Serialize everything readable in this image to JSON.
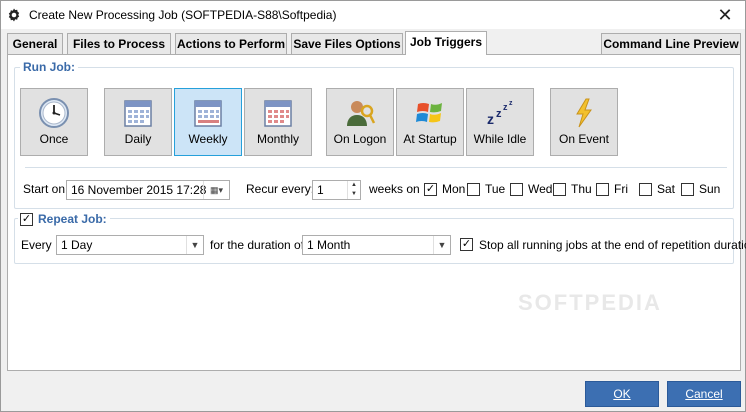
{
  "window": {
    "title": "Create New Processing Job (SOFTPEDIA-S88\\Softpedia)",
    "close": "✕"
  },
  "tabs": [
    {
      "label": "General"
    },
    {
      "label": "Files to Process"
    },
    {
      "label": "Actions to Perform"
    },
    {
      "label": "Save Files Options"
    },
    {
      "label": "Job Triggers"
    },
    {
      "label": "Command Line Preview"
    }
  ],
  "active_tab": "Job Triggers",
  "run_job": {
    "label": "Run Job:",
    "buttons": [
      {
        "label": "Once",
        "icon": "clock-icon"
      },
      {
        "label": "Daily",
        "icon": "calendar-icon"
      },
      {
        "label": "Weekly",
        "icon": "calendar-icon"
      },
      {
        "label": "Monthly",
        "icon": "calendar-red-icon"
      },
      {
        "label": "On Logon",
        "icon": "user-key-icon"
      },
      {
        "label": "At Startup",
        "icon": "windows-logo-icon"
      },
      {
        "label": "While Idle",
        "icon": "sleep-zzz-icon"
      },
      {
        "label": "On Event",
        "icon": "lightning-icon"
      }
    ],
    "selected": "Weekly",
    "start_on_label": "Start on:",
    "start_on_value": "16 November 2015 17:28",
    "recur_label": "Recur every:",
    "recur_value": "1",
    "weeks_on_label": "weeks on",
    "days": [
      {
        "label": "Mon",
        "checked": true
      },
      {
        "label": "Tue",
        "checked": false
      },
      {
        "label": "Wed",
        "checked": false
      },
      {
        "label": "Thu",
        "checked": false
      },
      {
        "label": "Fri",
        "checked": false
      },
      {
        "label": "Sat",
        "checked": false
      },
      {
        "label": "Sun",
        "checked": false
      }
    ]
  },
  "repeat_job": {
    "label": "Repeat Job:",
    "checked": true,
    "every_label": "Every",
    "every_value": "1 Day",
    "duration_label": "for the duration of:",
    "duration_value": "1 Month",
    "stop_label": "Stop all running jobs at the end of repetition duration",
    "stop_checked": true
  },
  "watermark": "SOFTPEDIA",
  "footer": {
    "ok": "OK",
    "cancel": "Cancel"
  },
  "colors": {
    "accent": "#3c6fb2",
    "group_label": "#3a6aa8",
    "selected_bg": "#cce4f7"
  }
}
